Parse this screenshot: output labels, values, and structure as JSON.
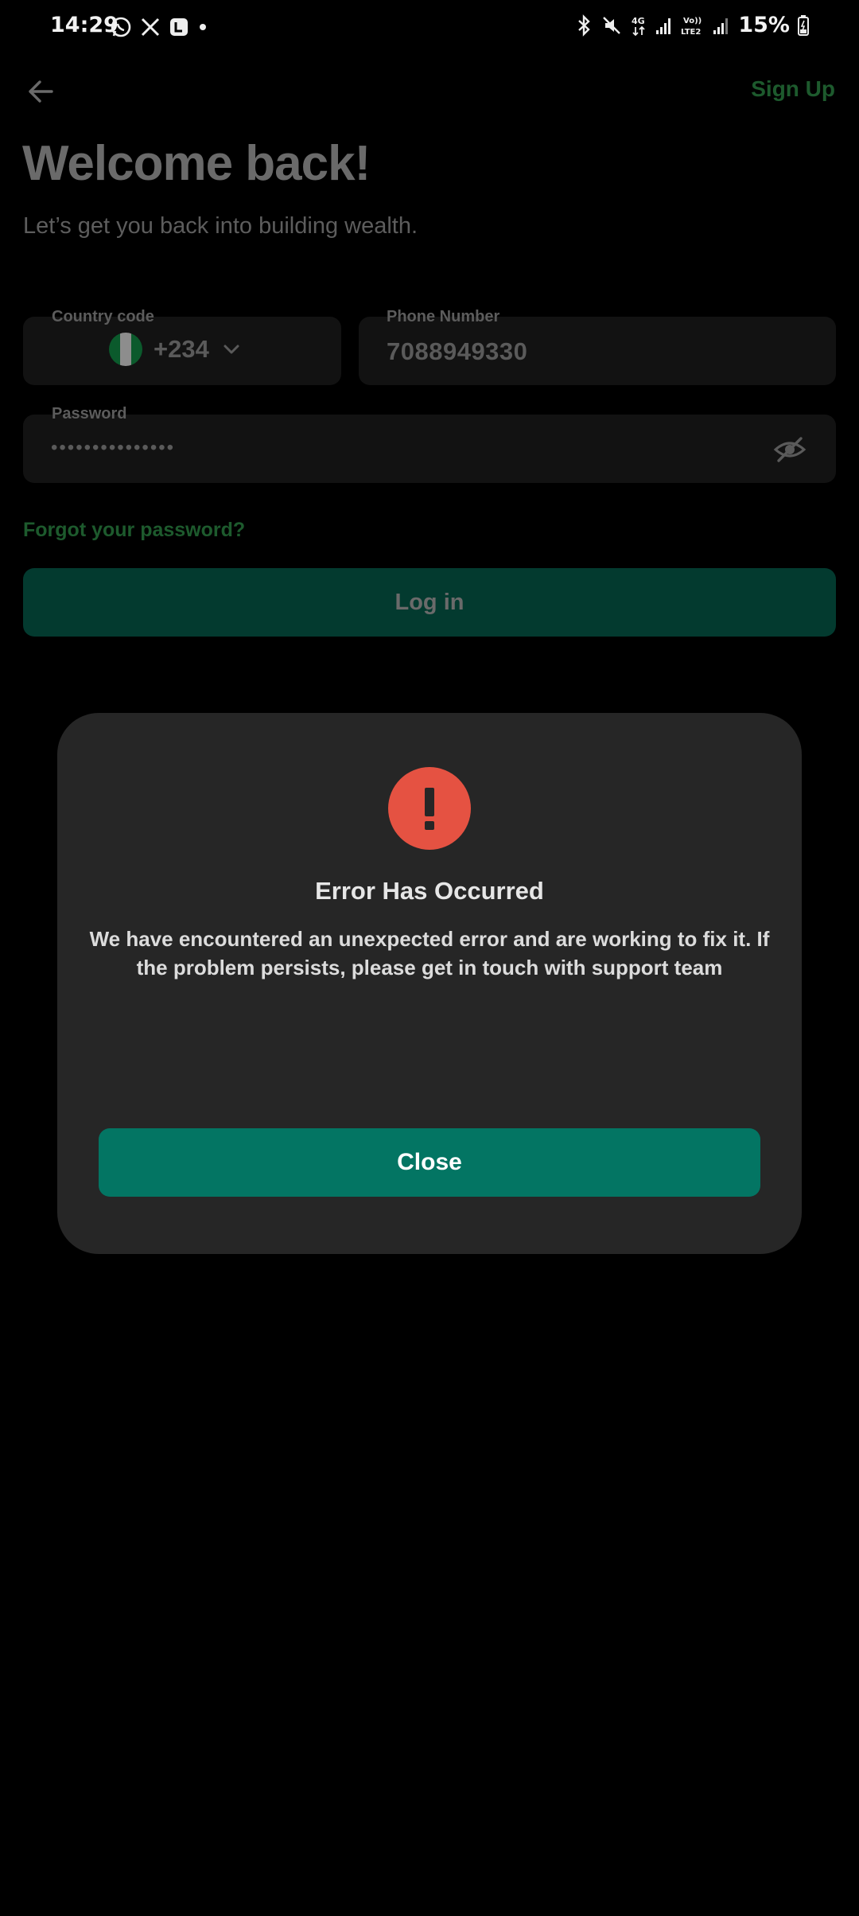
{
  "status_bar": {
    "time": "14:29",
    "battery": "15%",
    "network_4g": "4G",
    "network_volte": "VoLTE2"
  },
  "header": {
    "signup_label": "Sign Up"
  },
  "page": {
    "title": "Welcome back!",
    "subtitle": "Let’s get you back into building wealth."
  },
  "form": {
    "country_label": "Country code",
    "country_code": "+234",
    "phone_label": "Phone Number",
    "phone_value": "7088949330",
    "password_label": "Password",
    "password_value": "•••••••••••••••",
    "forgot_label": "Forgot your password?",
    "login_label": "Log in"
  },
  "modal": {
    "title": "Error Has Occurred",
    "message": "We have encountered an unexpected error and are working to fix it. If the problem persists, please get in touch with support team",
    "close_label": "Close"
  },
  "colors": {
    "accent_green": "#037563",
    "error_red": "#e55242",
    "dim_green": "#1d5a2d"
  },
  "icons": {
    "back": "arrow-left-icon",
    "eye": "eye-off-icon",
    "error": "exclamation-icon",
    "dropdown": "chevron-down-icon"
  }
}
